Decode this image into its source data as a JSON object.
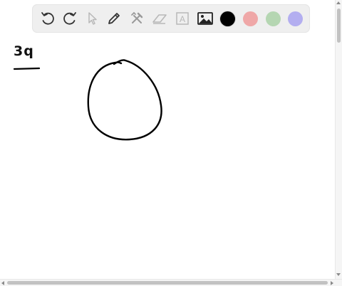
{
  "canvas": {
    "page_label": "3q",
    "ink_color": "#000000"
  },
  "toolbar": {
    "tools": [
      {
        "name": "undo",
        "icon": "undo-icon"
      },
      {
        "name": "redo",
        "icon": "redo-icon"
      },
      {
        "name": "select",
        "icon": "pointer-icon"
      },
      {
        "name": "pen",
        "icon": "pencil-icon"
      },
      {
        "name": "tools",
        "icon": "crossed-tools-icon"
      },
      {
        "name": "eraser",
        "icon": "eraser-icon"
      },
      {
        "name": "text",
        "icon": "text-box-icon",
        "label": "A"
      },
      {
        "name": "image",
        "icon": "image-icon"
      }
    ],
    "colors": [
      {
        "name": "black",
        "hex": "#000000",
        "selected": true
      },
      {
        "name": "red",
        "hex": "#efa7a7"
      },
      {
        "name": "green",
        "hex": "#b5d6b2"
      },
      {
        "name": "purple",
        "hex": "#b3aef0"
      }
    ]
  }
}
